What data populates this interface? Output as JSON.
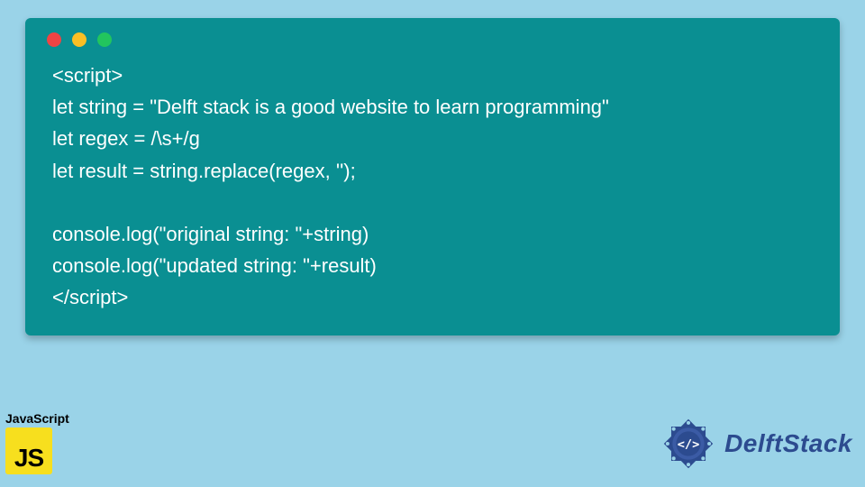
{
  "code": {
    "lines": [
      "<script>",
      "let string = \"Delft stack is a good website to learn programming\"",
      "let regex = /\\s+/g",
      "let result = string.replace(regex, '');",
      "",
      "console.log(\"original string: \"+string)",
      "console.log(\"updated string: \"+result)",
      "</script>"
    ]
  },
  "footer": {
    "js_label": "JavaScript",
    "js_letters": "JS",
    "brand_name": "DelftStack"
  }
}
